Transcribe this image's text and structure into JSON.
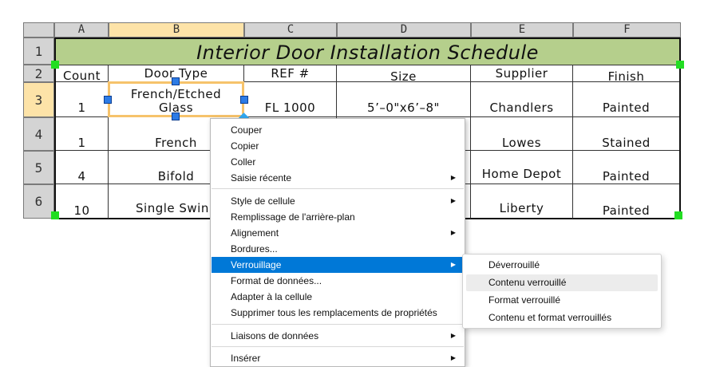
{
  "columns": [
    "A",
    "B",
    "C",
    "D",
    "E",
    "F"
  ],
  "rows": [
    "1",
    "2",
    "3",
    "4",
    "5",
    "6"
  ],
  "table_title": "Interior Door Installation Schedule",
  "headers": [
    "Count",
    "Door Type",
    "REF #",
    "Size",
    "Supplier",
    "Finish"
  ],
  "data_rows": [
    {
      "count": "1",
      "door_type_1": "French/Etched",
      "door_type_2": "Glass",
      "ref": "FL 1000",
      "size": "5’–0\"x6’–8\"",
      "supplier": "Chandlers",
      "finish": "Painted"
    },
    {
      "count": "1",
      "door_type": "French",
      "ref": "",
      "size": "",
      "supplier": "Lowes",
      "finish": "Stained"
    },
    {
      "count": "4",
      "door_type": "Bifold",
      "ref": "",
      "size": "",
      "supplier": "Home Depot",
      "finish": "Painted"
    },
    {
      "count": "10",
      "door_type": "Single Swin",
      "ref": "",
      "size": "",
      "supplier": "Liberty",
      "finish": "Painted"
    }
  ],
  "context_menu": {
    "items": [
      {
        "label": "Couper"
      },
      {
        "label": "Copier"
      },
      {
        "label": "Coller"
      },
      {
        "label": "Saisie récente"
      },
      {
        "label": "Style de cellule"
      },
      {
        "label": "Remplissage de l'arrière-plan"
      },
      {
        "label": "Alignement"
      },
      {
        "label": "Bordures..."
      },
      {
        "label": "Verrouillage"
      },
      {
        "label": "Format de données..."
      },
      {
        "label": "Adapter à la cellule"
      },
      {
        "label": "Supprimer tous les remplacements de propriétés"
      },
      {
        "label": "Liaisons de données"
      },
      {
        "label": "Insérer"
      }
    ],
    "highlighted": "Verrouillage"
  },
  "submenu": {
    "items": [
      {
        "label": "Déverrouillé"
      },
      {
        "label": "Contenu verrouillé"
      },
      {
        "label": "Format verrouillé"
      },
      {
        "label": "Contenu et format verrouillés"
      }
    ],
    "hovered": "Contenu verrouillé"
  },
  "colors": {
    "title_fill": "#b5cf8c",
    "header_fill": "#d4d4d4",
    "selected_header_fill": "#fde3a8",
    "selection_border": "#f6c36b",
    "grip": "#22dd22",
    "handle": "#2d7be5",
    "menu_highlight": "#0078d7"
  }
}
